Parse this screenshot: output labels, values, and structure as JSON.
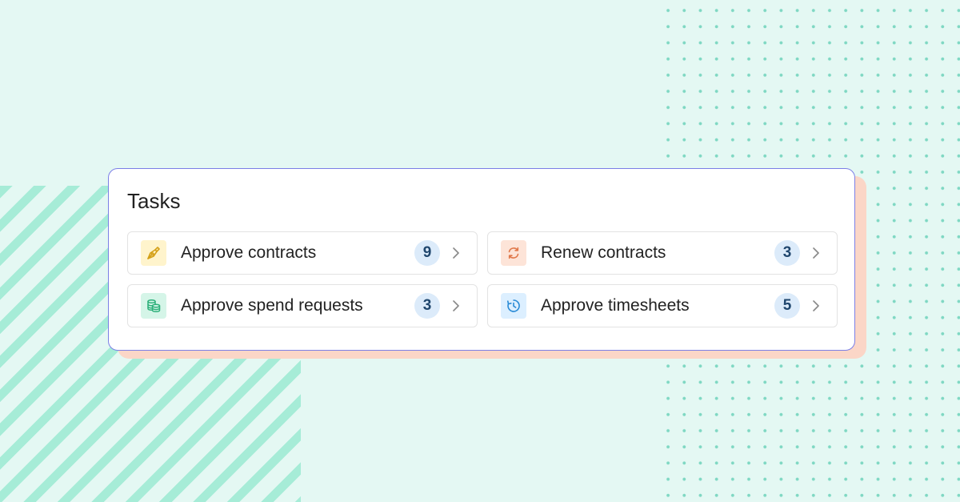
{
  "card": {
    "title": "Tasks"
  },
  "tasks": [
    {
      "label": "Approve contracts",
      "count": "9",
      "icon": "pen-nib-icon",
      "icon_bg": "#fff4cc",
      "icon_color": "#d4a017"
    },
    {
      "label": "Renew contracts",
      "count": "3",
      "icon": "refresh-icon",
      "icon_bg": "#fde4d8",
      "icon_color": "#e0784a"
    },
    {
      "label": "Approve spend requests",
      "count": "3",
      "icon": "coins-stack-icon",
      "icon_bg": "#d5f5e8",
      "icon_color": "#2db07a"
    },
    {
      "label": "Approve timesheets",
      "count": "5",
      "icon": "clock-icon",
      "icon_bg": "#dcefff",
      "icon_color": "#2a8bd6"
    }
  ],
  "colors": {
    "background": "#e4f8f3",
    "stripes": "#a6ecd7",
    "dots": "#7fd8c3",
    "card_border": "#7b7fe6",
    "card_shadow": "#fbd6c7",
    "count_badge_bg": "#dcebfa",
    "count_badge_text": "#20476e"
  }
}
